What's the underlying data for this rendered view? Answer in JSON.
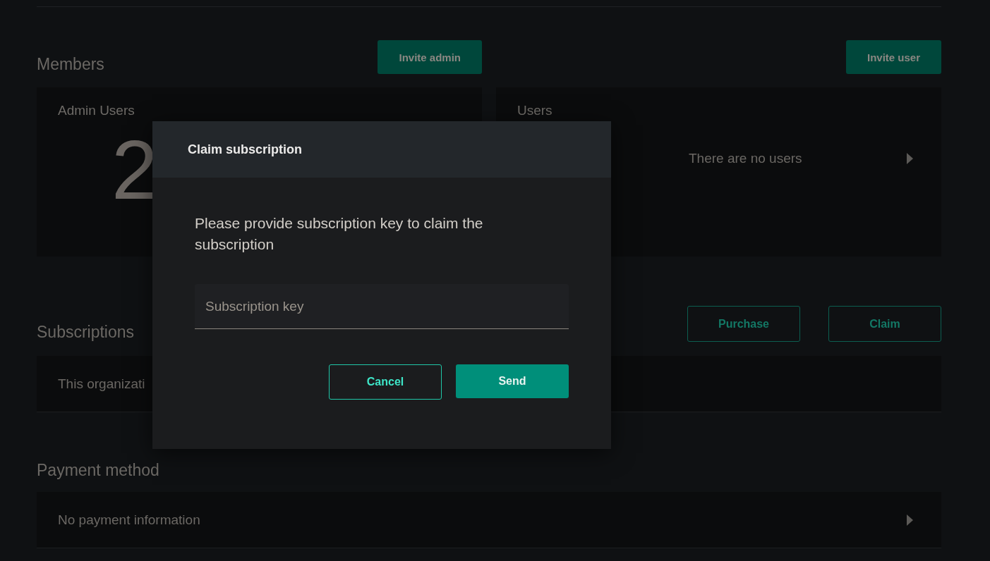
{
  "members": {
    "title": "Members",
    "invite_admin": "Invite admin",
    "invite_user": "Invite user",
    "admin_card": {
      "title": "Admin Users",
      "count": "2"
    },
    "users_card": {
      "title": "Users",
      "empty": "There are no users"
    }
  },
  "subscriptions": {
    "title": "Subscriptions",
    "buttons": [
      "Purchase",
      "Claim"
    ],
    "message": "This organizati"
  },
  "payment": {
    "title": "Payment method",
    "message": "No payment information"
  },
  "dialog": {
    "title": "Claim subscription",
    "message": "Please provide subscription key to claim the subscription",
    "field": {
      "placeholder": "Subscription key"
    },
    "buttons": [
      {
        "label": "Cancel",
        "kind": "outline"
      },
      {
        "label": "Send",
        "kind": "filled"
      }
    ]
  }
}
